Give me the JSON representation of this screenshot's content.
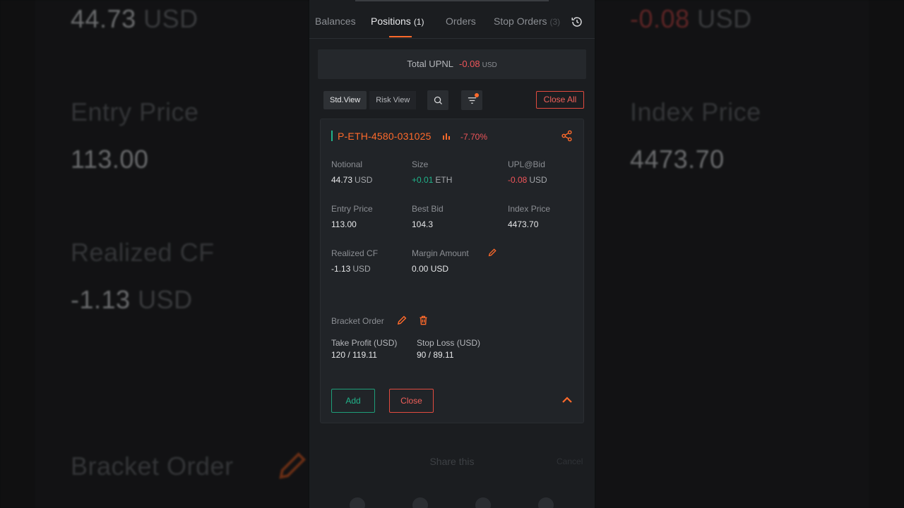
{
  "background": {
    "left": {
      "notional_value": "44.73",
      "notional_unit": "USD",
      "entry_price_label": "Entry Price",
      "entry_price_value": "113.00",
      "realized_cf_label": "Realized CF",
      "realized_cf_value": "-1.13",
      "realized_cf_unit": "USD",
      "bracket_order_label": "Bracket Order"
    },
    "right": {
      "upl_value": "-0.08",
      "upl_unit": "USD",
      "index_price_label": "Index Price",
      "index_price_value": "4473.70"
    }
  },
  "tabs": [
    {
      "label": "Balances",
      "count": ""
    },
    {
      "label": "Positions",
      "count": "(1)"
    },
    {
      "label": "Orders",
      "count": ""
    },
    {
      "label": "Stop Orders",
      "count": "(3)"
    }
  ],
  "summary": {
    "total_upnl_label": "Total UPNL",
    "total_upnl_value": "-0.08",
    "total_upnl_unit": "USD"
  },
  "toolbar": {
    "std_view_label": "Std.View",
    "risk_view_label": "Risk View",
    "close_all_label": "Close All"
  },
  "position": {
    "symbol": "P-ETH-4580-031025",
    "change_pct": "-7.70%",
    "fields": {
      "notional_label": "Notional",
      "notional_value": "44.73",
      "notional_unit": "USD",
      "size_label": "Size",
      "size_value": "+0.01",
      "size_unit": "ETH",
      "upl_label": "UPL@Bid",
      "upl_value": "-0.08",
      "upl_unit": "USD",
      "entry_price_label": "Entry Price",
      "entry_price_value": "113.00",
      "best_bid_label": "Best Bid",
      "best_bid_value": "104.3",
      "index_price_label": "Index Price",
      "index_price_value": "4473.70",
      "realized_cf_label": "Realized CF",
      "realized_cf_value": "-1.13",
      "realized_cf_unit": "USD",
      "margin_amount_label": "Margin Amount",
      "margin_amount_value": "0.00 USD"
    },
    "bracket": {
      "label": "Bracket Order",
      "take_profit_label": "Take Profit (USD)",
      "take_profit_value": "120 / 119.11",
      "stop_loss_label": "Stop Loss (USD)",
      "stop_loss_value": "90 / 89.11"
    },
    "add_label": "Add",
    "close_label": "Close"
  },
  "share_sheet": {
    "title": "Share this",
    "cancel_label": "Cancel"
  },
  "colors": {
    "accent": "#ff6a2b",
    "positive": "#21b38a",
    "negative": "#f0555a",
    "panel": "#212428"
  }
}
